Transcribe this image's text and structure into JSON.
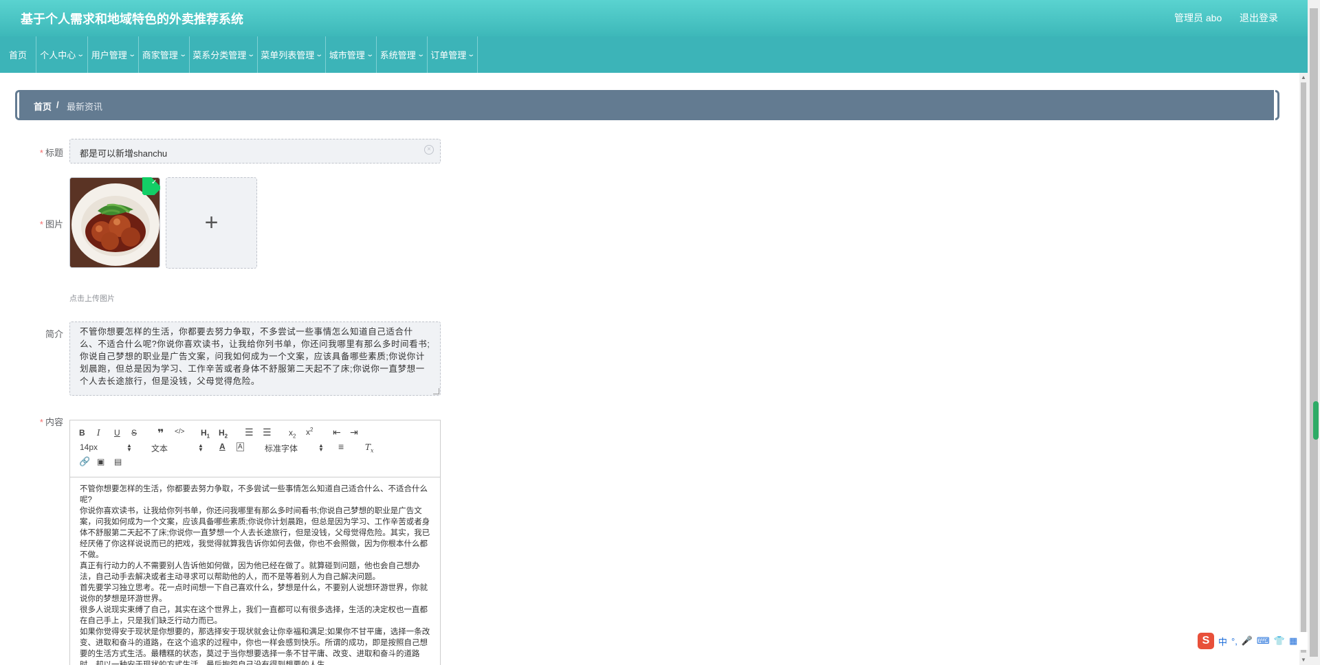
{
  "header": {
    "title": "基于个人需求和地域特色的外卖推荐系统",
    "admin": "管理员 abo",
    "logout": "退出登录"
  },
  "nav": [
    {
      "label": "首页",
      "dropdown": false
    },
    {
      "label": "个人中心",
      "dropdown": true
    },
    {
      "label": "用户管理",
      "dropdown": true
    },
    {
      "label": "商家管理",
      "dropdown": true
    },
    {
      "label": "菜系分类管理",
      "dropdown": true
    },
    {
      "label": "菜单列表管理",
      "dropdown": true
    },
    {
      "label": "城市管理",
      "dropdown": true
    },
    {
      "label": "系统管理",
      "dropdown": true
    },
    {
      "label": "订单管理",
      "dropdown": true
    }
  ],
  "breadcrumb": {
    "home": "首页",
    "separator": "/",
    "current": "最新资讯"
  },
  "form": {
    "title_label": "标题",
    "title_value": "都是可以新增shanchu",
    "image_label": "图片",
    "upload_tip": "点击上传图片",
    "intro_label": "简介",
    "intro_value": "不管你想要怎样的生活，你都要去努力争取，不多尝试一些事情怎么知道自己适合什么、不适合什么呢?你说你喜欢读书，让我给你列书单，你还问我哪里有那么多时间看书;你说自己梦想的职业是广告文案，问我如何成为一个文案，应该具备哪些素质;你说你计划晨跑，但总是因为学习、工作辛苦或者身体不舒服第二天起不了床;你说你一直梦想一个人去长途旅行，但是没钱，父母觉得危险。",
    "content_label": "内容"
  },
  "editor": {
    "font_size": "14px",
    "paragraph": "文本",
    "font_family": "标准字体",
    "paragraphs": [
      "不管你想要怎样的生活，你都要去努力争取，不多尝试一些事情怎么知道自己适合什么、不适合什么呢?",
      "你说你喜欢读书，让我给你列书单，你还问我哪里有那么多时间看书;你说自己梦想的职业是广告文案，问我如何成为一个文案，应该具备哪些素质;你说你计划晨跑，但总是因为学习、工作辛苦或者身体不舒服第二天起不了床;你说你一直梦想一个人去长途旅行，但是没钱，父母觉得危险。其实，我已经厌倦了你这样说说而已的把戏，我觉得就算我告诉你如何去做，你也不会照做，因为你根本什么都不做。",
      "真正有行动力的人不需要别人告诉他如何做，因为他已经在做了。就算碰到问题，他也会自己想办法，自己动手去解决或者主动寻求可以帮助他的人，而不是等着别人为自己解决问题。",
      "首先要学习独立思考。花一点时间想一下自己喜欢什么，梦想是什么，不要别人说想环游世界，你就说你的梦想是环游世界。",
      "很多人说现实束缚了自己，其实在这个世界上，我们一直都可以有很多选择，生活的决定权也一直都在自己手上，只是我们缺乏行动力而已。",
      "如果你觉得安于现状是你想要的，那选择安于现状就会让你幸福和满足;如果你不甘平庸，选择一条改变、进取和奋斗的道路，在这个追求的过程中，你也一样会感到快乐。所谓的成功，即是按照自己想要的生活方式生活。最糟糕的状态，莫过于当你想要选择一条不甘平庸、改变、进取和奋斗的道路时，却以一种安于现状的方式生活，最后抱怨自己没有得到想要的人生。"
    ]
  },
  "ime": {
    "lang": "中",
    "punct": "°,"
  },
  "colors": {
    "header_top": "#5ad3d0",
    "nav": "#3cb4b8",
    "breadcrumb": "#637b91",
    "required": "#f56c6c",
    "success": "#13ce66"
  }
}
